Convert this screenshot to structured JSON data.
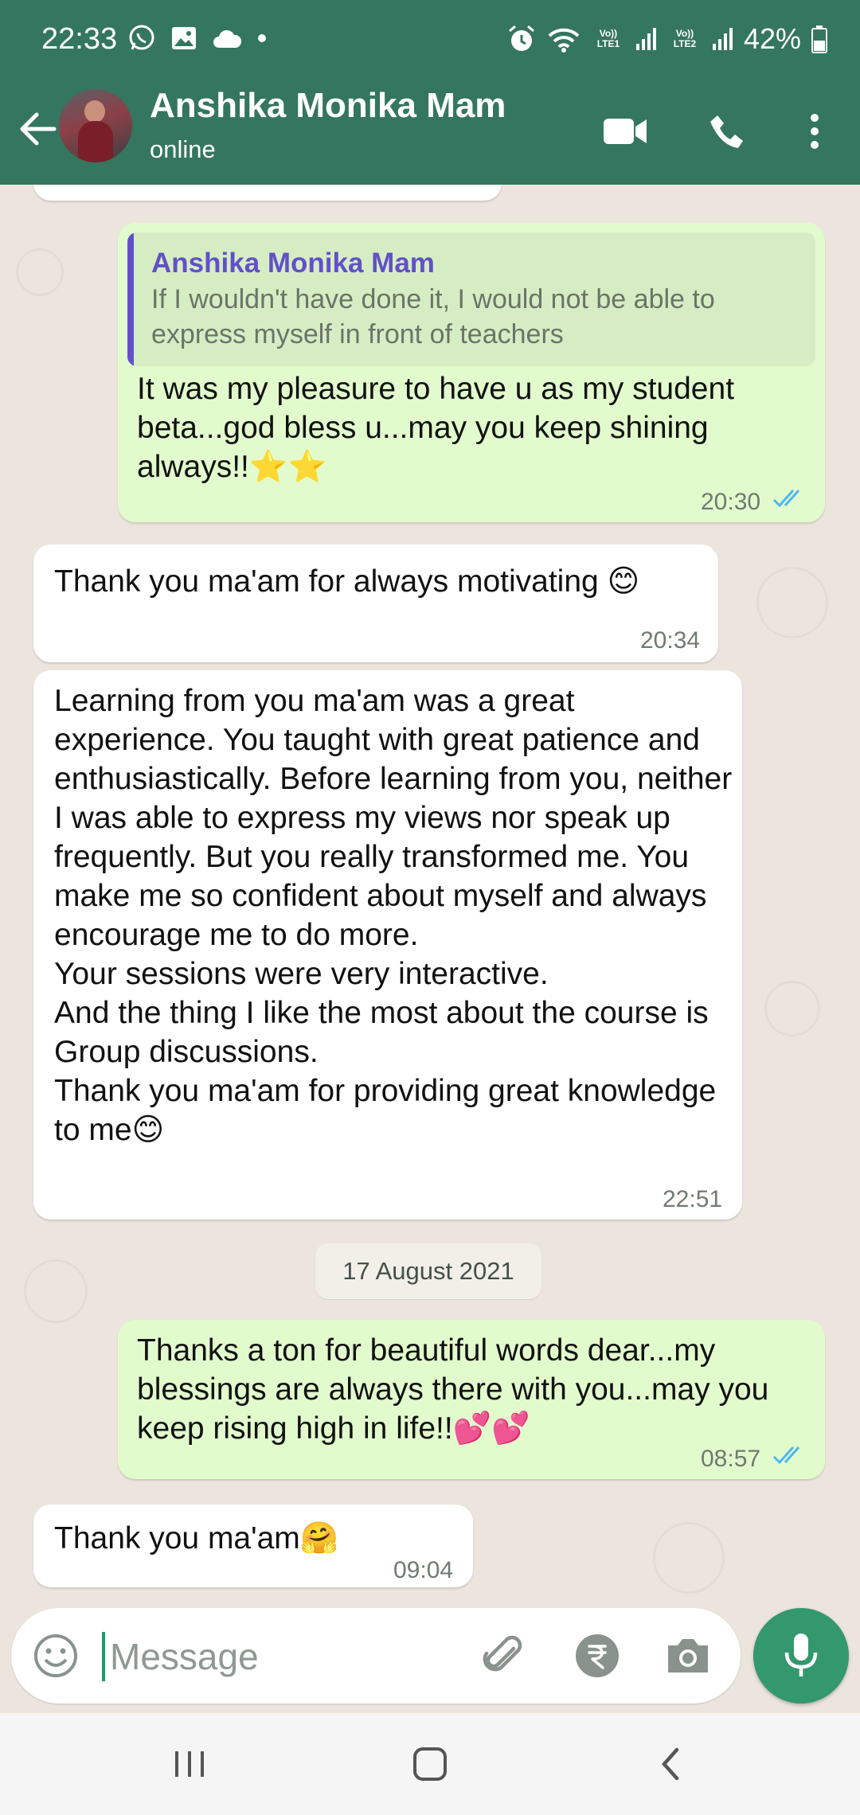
{
  "status_bar": {
    "time": "22:33",
    "battery": "42%",
    "sim1": "Vo)) LTE1",
    "sim2": "Vo)) LTE2",
    "icons": [
      "whatsapp-icon",
      "gallery-icon",
      "cloud-icon",
      "dot-icon",
      "alarm-icon",
      "wifi-icon",
      "signal-icon",
      "battery-icon"
    ]
  },
  "header": {
    "contact_name": "Anshika Monika Mam",
    "status": "online",
    "icons": [
      "back-arrow-icon",
      "video-call-icon",
      "phone-icon",
      "more-icon"
    ],
    "accent": "#34765f"
  },
  "messages": [
    {
      "id": "m1",
      "direction": "out",
      "quote": {
        "author": "Anshika Monika Mam",
        "text": "If I wouldn't have done it, I would not be able to express myself in front of teachers"
      },
      "text": "It was my pleasure to have u as my student beta...god bless u...may you keep shining always!!⭐⭐",
      "time": "20:30",
      "read": true
    },
    {
      "id": "m2",
      "direction": "in",
      "text": "Thank you ma'am for always motivating 😊",
      "time": "20:34"
    },
    {
      "id": "m3",
      "direction": "in",
      "text": "Learning from you ma'am was a great experience. You taught with great patience and enthusiastically. Before learning from you, neither I was able to express my views nor speak up frequently. But you really transformed me. You make me so confident about myself and always encourage me to do more.\nYour sessions were very interactive.\nAnd the thing I like the most about the course is Group discussions.\nThank you ma'am for providing great knowledge to me😊",
      "time": "22:51"
    },
    {
      "id": "m4",
      "direction": "out",
      "text": "Thanks a ton for beautiful words dear...my blessings are always there with you...may you keep rising high in life!!💕💕",
      "time": "08:57",
      "read": true
    },
    {
      "id": "m5",
      "direction": "in",
      "text": "Thank you ma'am🤗",
      "time": "09:04"
    }
  ],
  "date_separator": "17 August 2021",
  "composer": {
    "placeholder": "Message",
    "icons": [
      "emoji-icon",
      "attach-icon",
      "rupee-payment-icon",
      "camera-icon",
      "mic-icon"
    ]
  },
  "colors": {
    "outgoing_bubble": "#e2fbcd",
    "incoming_bubble": "#ffffff",
    "chat_background": "#ece5dd",
    "read_tick": "#4fb6ec"
  }
}
